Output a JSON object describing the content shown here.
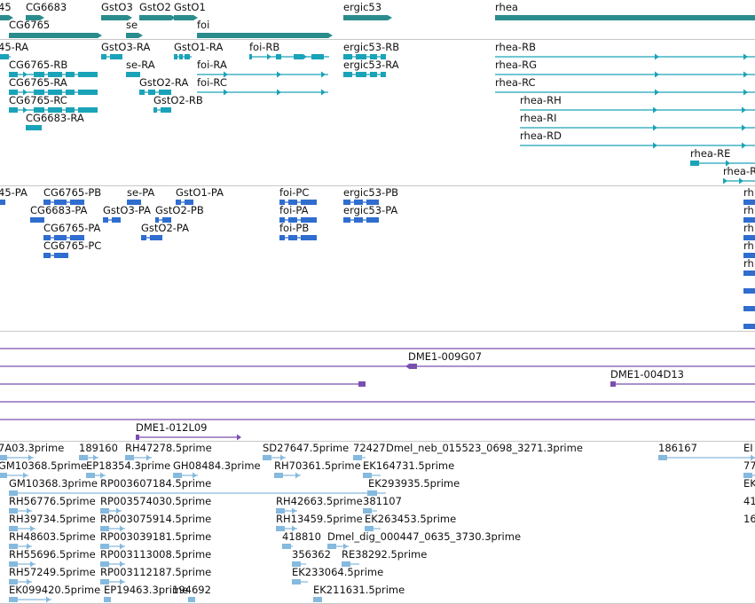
{
  "colors": {
    "gene": "#2a8c8c",
    "transcript": "#1aa3b8",
    "cds": "#2f6dcf",
    "bac": "#7a4fb0",
    "est": "#86b9de"
  },
  "tracks": {
    "genes": {
      "features": [
        {
          "label": "45"
        },
        {
          "label": "CG6683"
        },
        {
          "label": "GstO3"
        },
        {
          "label": "GstO2"
        },
        {
          "label": "GstO1"
        },
        {
          "label": "ergic53"
        },
        {
          "label": "rhea"
        },
        {
          "label": "CG6765"
        },
        {
          "label": "se"
        },
        {
          "label": "foi"
        }
      ]
    },
    "transcripts": {
      "features": [
        {
          "label": "45-RA"
        },
        {
          "label": "GstO3-RA"
        },
        {
          "label": "GstO1-RA"
        },
        {
          "label": "foi-RB"
        },
        {
          "label": "ergic53-RB"
        },
        {
          "label": "rhea-RB"
        },
        {
          "label": "CG6765-RB"
        },
        {
          "label": "se-RA"
        },
        {
          "label": "foi-RA"
        },
        {
          "label": "ergic53-RA"
        },
        {
          "label": "rhea-RG"
        },
        {
          "label": "CG6765-RA"
        },
        {
          "label": "GstO2-RA"
        },
        {
          "label": "foi-RC"
        },
        {
          "label": "rhea-RC"
        },
        {
          "label": "CG6765-RC"
        },
        {
          "label": "GstO2-RB"
        },
        {
          "label": "rhea-RH"
        },
        {
          "label": "CG6683-RA"
        },
        {
          "label": "rhea-RI"
        },
        {
          "label": "rhea-RD"
        },
        {
          "label": "rhea-RE"
        },
        {
          "label": "rhea-R"
        }
      ]
    },
    "cds": {
      "features": [
        {
          "label": "45-PA"
        },
        {
          "label": "CG6765-PB"
        },
        {
          "label": "se-PA"
        },
        {
          "label": "GstO1-PA"
        },
        {
          "label": "foi-PC"
        },
        {
          "label": "ergic53-PB"
        },
        {
          "label": "CG6683-PA"
        },
        {
          "label": "GstO3-PA"
        },
        {
          "label": "GstO2-PB"
        },
        {
          "label": "foi-PA"
        },
        {
          "label": "ergic53-PA"
        },
        {
          "label": "CG6765-PA"
        },
        {
          "label": "GstO2-PA"
        },
        {
          "label": "foi-PB"
        },
        {
          "label": "CG6765-PC"
        },
        {
          "label": "rh"
        },
        {
          "label": "rh"
        },
        {
          "label": "rh"
        },
        {
          "label": "rh"
        },
        {
          "label": "rh"
        }
      ]
    },
    "bac": {
      "features": [
        {
          "label": "DME1-009G07"
        },
        {
          "label": "DME1-004D13"
        },
        {
          "label": "DME1-012L09"
        }
      ]
    },
    "est": {
      "features": [
        {
          "label": "7A03.3prime"
        },
        {
          "label": "189160"
        },
        {
          "label": "RH47278.5prime"
        },
        {
          "label": "SD27647.5prime"
        },
        {
          "label": "72427"
        },
        {
          "label": "Dmel_neb_015523_0698_3271.3prime"
        },
        {
          "label": "186167"
        },
        {
          "label": "EI"
        },
        {
          "label": "GM10368.5prime"
        },
        {
          "label": "EP18354.3prime"
        },
        {
          "label": "GH08484.3prime"
        },
        {
          "label": "RH70361.5prime"
        },
        {
          "label": "EK164731.5prime"
        },
        {
          "label": "77"
        },
        {
          "label": "GM10368.3prime"
        },
        {
          "label": "RP003607184.5prime"
        },
        {
          "label": "EK293935.5prime"
        },
        {
          "label": "EK"
        },
        {
          "label": "RH56776.5prime"
        },
        {
          "label": "RP003574030.5prime"
        },
        {
          "label": "RH42663.5prime"
        },
        {
          "label": "381107"
        },
        {
          "label": "41"
        },
        {
          "label": "RH39734.5prime"
        },
        {
          "label": "RP003075914.5prime"
        },
        {
          "label": "RH13459.5prime"
        },
        {
          "label": "EK263453.5prime"
        },
        {
          "label": "16"
        },
        {
          "label": "RH48603.5prime"
        },
        {
          "label": "RP003039181.5prime"
        },
        {
          "label": "418810"
        },
        {
          "label": "Dmel_dig_000447_0635_3730.3prime"
        },
        {
          "label": "RH55696.5prime"
        },
        {
          "label": "RP003113008.5prime"
        },
        {
          "label": "356362"
        },
        {
          "label": "RE38292.5prime"
        },
        {
          "label": "RH57249.5prime"
        },
        {
          "label": "RP003112187.5prime"
        },
        {
          "label": "EK233064.5prime"
        },
        {
          "label": "EK099420.5prime"
        },
        {
          "label": "EP19463.3prime"
        },
        {
          "label": "194692"
        },
        {
          "label": "EK211631.5prime"
        }
      ]
    }
  }
}
